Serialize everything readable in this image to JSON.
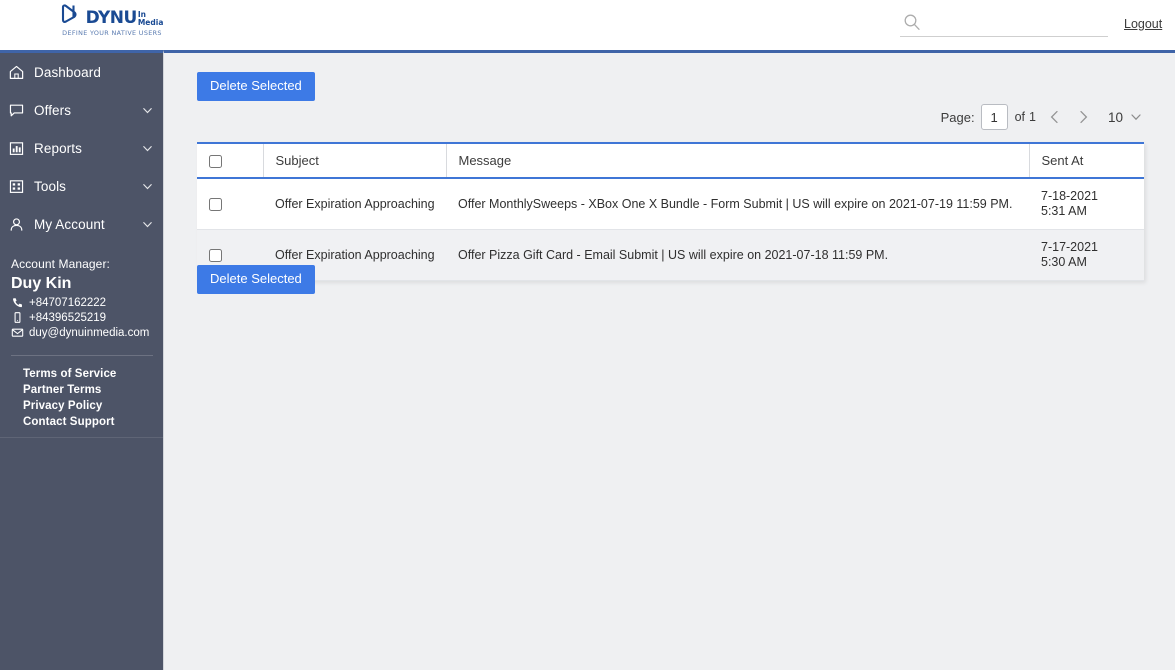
{
  "header": {
    "logo": {
      "word": "DYNU",
      "sub_line1": "In",
      "sub_line2": "Media",
      "tagline": "DEFINE YOUR NATIVE USERS"
    },
    "search": {
      "value": "",
      "placeholder": ""
    },
    "logout_label": "Logout"
  },
  "sidebar": {
    "items": [
      {
        "label": "Dashboard",
        "icon": "home-icon",
        "expandable": false
      },
      {
        "label": "Offers",
        "icon": "message-icon",
        "expandable": true
      },
      {
        "label": "Reports",
        "icon": "bar-chart-icon",
        "expandable": true
      },
      {
        "label": "Tools",
        "icon": "grid-icon",
        "expandable": true
      },
      {
        "label": "My Account",
        "icon": "user-icon",
        "expandable": true
      }
    ],
    "account_manager": {
      "title": "Account Manager:",
      "name": "Duy Kin",
      "phone": "+84707162222",
      "mobile": "+84396525219",
      "email": "duy@dynuinmedia.com"
    },
    "footer_links": [
      "Terms of Service",
      "Partner Terms",
      "Privacy Policy",
      "Contact Support"
    ]
  },
  "main": {
    "delete_button_label": "Delete Selected",
    "pagination": {
      "page_label": "Page:",
      "page_value": "1",
      "of_label": "of",
      "total_pages": "1",
      "per_page": "10"
    },
    "table": {
      "columns": [
        "",
        "Subject",
        "Message",
        "Sent At"
      ],
      "rows": [
        {
          "subject": "Offer Expiration Approaching",
          "message": "Offer MonthlySweeps - XBox One X Bundle - Form Submit | US will expire on 2021-07-19 11:59 PM.",
          "sent_date": "7-18-2021",
          "sent_time": "5:31 AM"
        },
        {
          "subject": "Offer Expiration Approaching",
          "message": "Offer Pizza Gift Card - Email Submit | US will expire on 2021-07-18 11:59 PM.",
          "sent_date": "7-17-2021",
          "sent_time": "5:30 AM"
        }
      ]
    }
  },
  "colors": {
    "sidebar_bg": "#4d5467",
    "accent_blue": "#3f64a8",
    "button_blue": "#3d7ae6",
    "table_border_blue": "#3f76d6",
    "content_bg": "#eff0f2",
    "logo_blue": "#1a4a93"
  }
}
